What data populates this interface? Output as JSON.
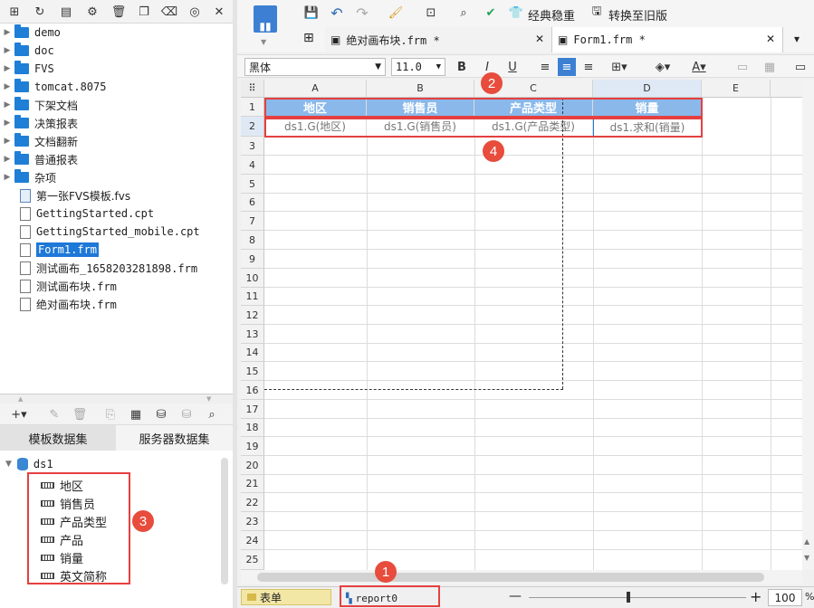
{
  "left_toolbar": {
    "icons": [
      "new-folder-icon",
      "refresh-icon",
      "template-icon",
      "settings-icon",
      "delete-icon",
      "copy-icon",
      "trash-icon",
      "locate-icon",
      "collapse-icon"
    ]
  },
  "file_tree": {
    "folders": [
      "demo",
      "doc",
      "FVS",
      "tomcat.8075",
      "下架文档",
      "决策报表",
      "文档翻新",
      "普通报表",
      "杂项"
    ],
    "files": [
      {
        "label": "第一张FVS模板.fvs",
        "type": "fvs"
      },
      {
        "label": "GettingStarted.cpt",
        "type": "cpt"
      },
      {
        "label": "GettingStarted_mobile.cpt",
        "type": "cpt"
      },
      {
        "label": "Form1.frm",
        "type": "frm",
        "selected": true
      },
      {
        "label": "测试画布_1658203281898.frm",
        "type": "frm"
      },
      {
        "label": "测试画布块.frm",
        "type": "frm"
      },
      {
        "label": "绝对画布块.frm",
        "type": "frm"
      }
    ]
  },
  "dataset_tabs": {
    "template": "模板数据集",
    "server": "服务器数据集"
  },
  "dataset": {
    "name": "ds1",
    "fields": [
      "地区",
      "销售员",
      "产品类型",
      "产品",
      "销量",
      "英文简称"
    ]
  },
  "main_toolbar": {
    "classic_label": "经典稳重",
    "switch_label": "转换至旧版"
  },
  "file_tabs": [
    {
      "label": "绝对画布块.frm *"
    },
    {
      "label": "Form1.frm *"
    }
  ],
  "format": {
    "font": "黑体",
    "size": "11.0"
  },
  "sheet": {
    "columns": [
      "A",
      "B",
      "C",
      "D",
      "E"
    ],
    "rows": [
      "1",
      "2",
      "3",
      "4",
      "5",
      "6",
      "7",
      "8",
      "9",
      "10",
      "11",
      "12",
      "13",
      "14",
      "15",
      "16",
      "17",
      "18",
      "19",
      "20",
      "21",
      "22",
      "23",
      "24",
      "25"
    ],
    "header_cells": [
      "地区",
      "销售员",
      "产品类型",
      "销量"
    ],
    "data_cells": [
      "ds1.G(地区)",
      "ds1.G(销售员)",
      "ds1.G(产品类型)",
      "ds1.求和(销量)"
    ]
  },
  "status": {
    "sheet_tab": "表单",
    "report_tab": "report0",
    "zoom": "100"
  },
  "badges": [
    "1",
    "2",
    "3",
    "4"
  ],
  "colors": {
    "accent": "#1e78d7",
    "header_fill": "#8ab8ea",
    "annotation": "#e54040"
  }
}
